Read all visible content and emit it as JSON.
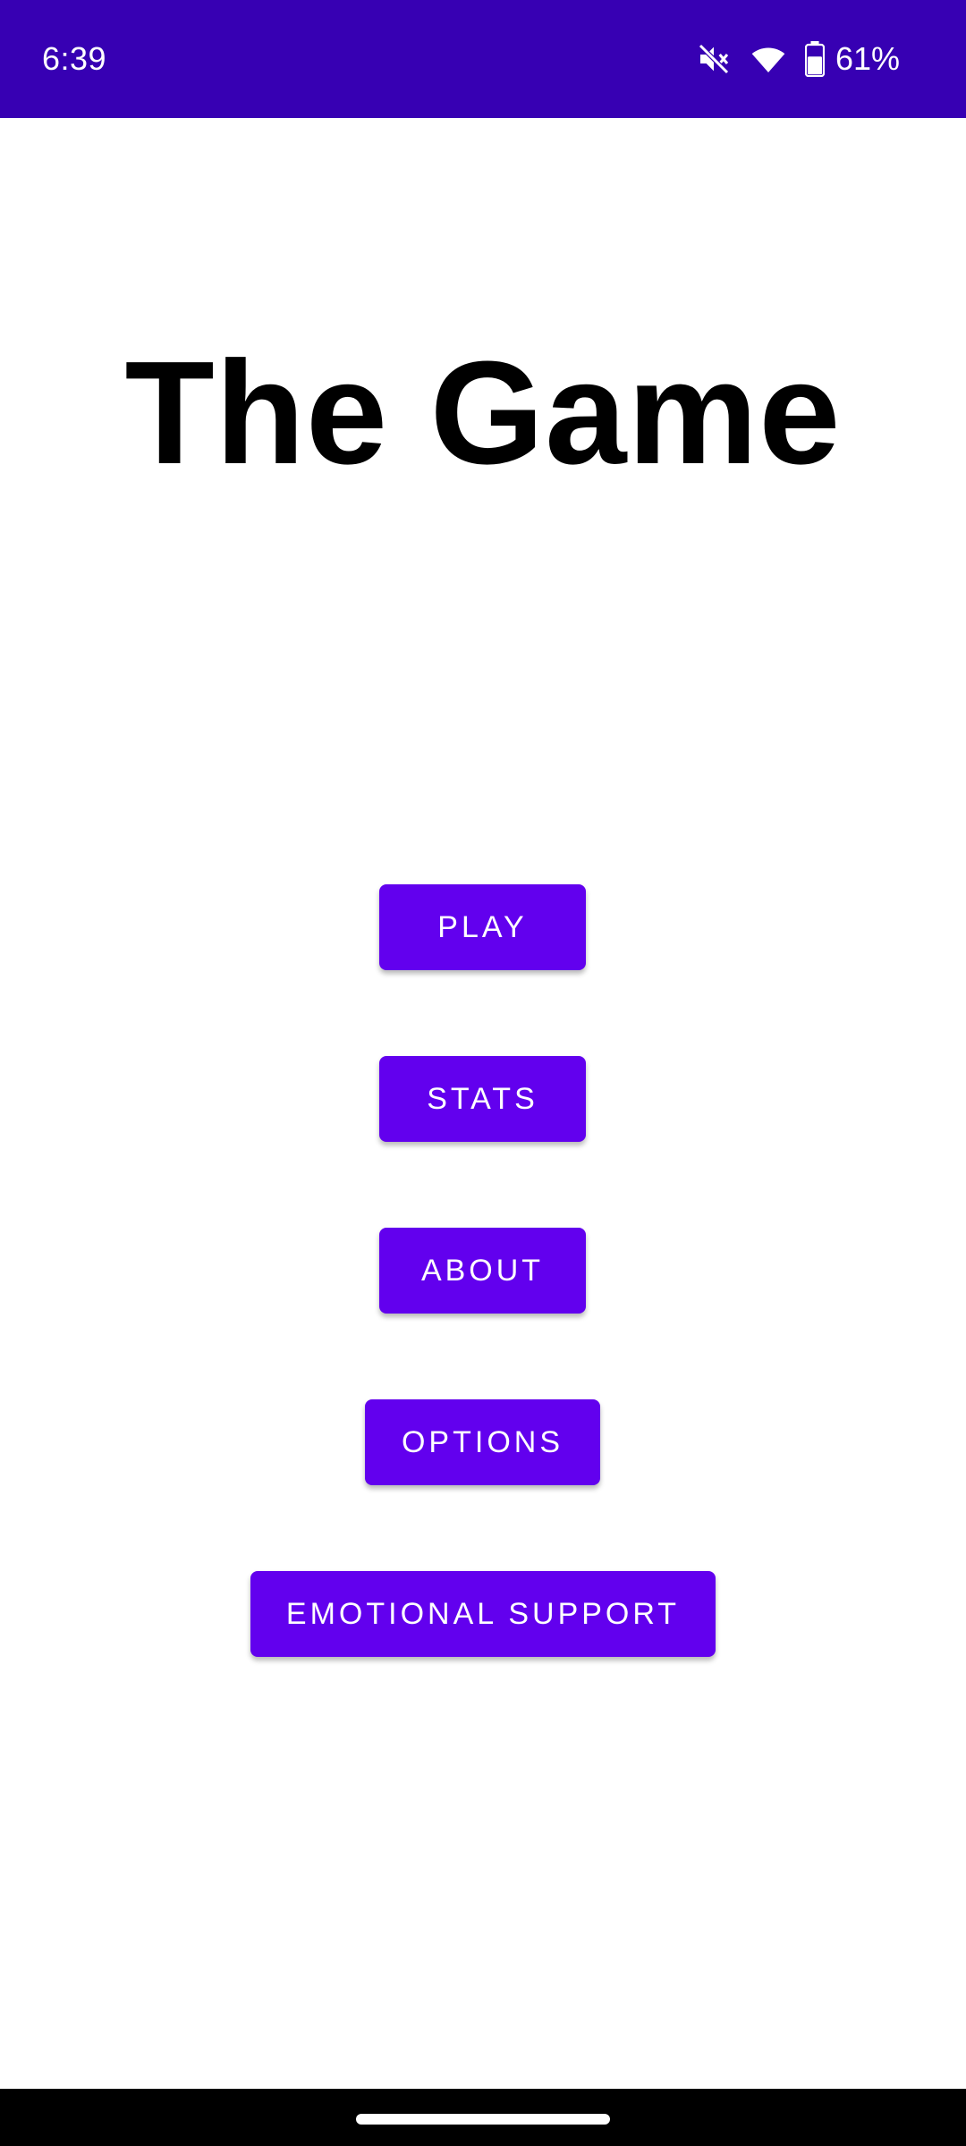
{
  "status_bar": {
    "time": "6:39",
    "battery_percent": "61%",
    "icons": [
      "mute-icon",
      "wifi-icon",
      "battery-icon"
    ],
    "background_color": "#3700b3"
  },
  "app": {
    "title": "The Game"
  },
  "menu": {
    "play_label": "PLAY",
    "stats_label": "STATS",
    "about_label": "ABOUT",
    "options_label": "OPTIONS",
    "support_label": "EMOTIONAL SUPPORT",
    "button_color": "#6200ee"
  }
}
